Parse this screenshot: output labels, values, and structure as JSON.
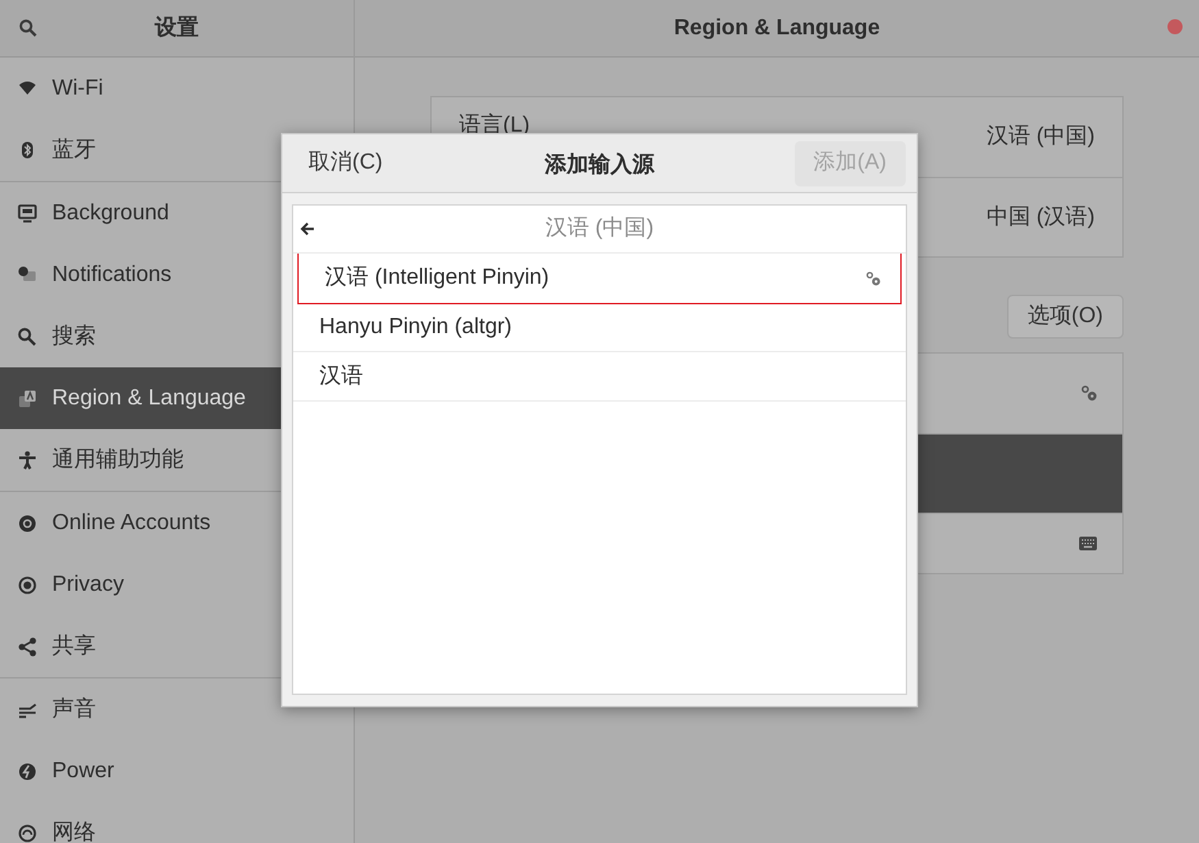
{
  "window": {
    "sidebar_title": "设置",
    "title": "Region & Language"
  },
  "sidebar": {
    "groups": [
      [
        {
          "kind": "wifi",
          "label": "Wi-Fi",
          "selected": false
        },
        {
          "kind": "bluetooth",
          "label": "蓝牙",
          "selected": false
        }
      ],
      [
        {
          "kind": "background",
          "label": "Background",
          "selected": false
        },
        {
          "kind": "notifications",
          "label": "Notifications",
          "selected": false
        },
        {
          "kind": "search",
          "label": "搜索",
          "selected": false
        },
        {
          "kind": "region",
          "label": "Region & Language",
          "selected": true
        },
        {
          "kind": "accessibility",
          "label": "通用辅助功能",
          "selected": false
        }
      ],
      [
        {
          "kind": "online",
          "label": "Online Accounts",
          "selected": false
        },
        {
          "kind": "privacy",
          "label": "Privacy",
          "selected": false
        },
        {
          "kind": "share",
          "label": "共享",
          "selected": false
        }
      ],
      [
        {
          "kind": "sound",
          "label": "声音",
          "selected": false
        },
        {
          "kind": "power",
          "label": "Power",
          "selected": false
        },
        {
          "kind": "network",
          "label": "网络",
          "selected": false
        }
      ]
    ]
  },
  "language_rows": [
    {
      "label": "语言(L)",
      "value": "汉语 (中国)"
    },
    {
      "value": "中国 (汉语)"
    }
  ],
  "options_button": "选项(O)",
  "input_sources": [
    {
      "kind": "settings",
      "selected": false
    },
    {
      "kind": "plain",
      "selected": true
    },
    {
      "kind": "keyboard",
      "selected": false
    }
  ],
  "dialog": {
    "cancel": "取消(C)",
    "title": "添加输入源",
    "add": {
      "label": "添加(A)",
      "disabled": true
    },
    "back_label": "汉语 (中国)",
    "items": [
      {
        "label": "汉语 (Intelligent Pinyin)",
        "selected": true,
        "settings": true
      },
      {
        "label": "Hanyu Pinyin (altgr)",
        "selected": false,
        "settings": false
      },
      {
        "label": "汉语",
        "selected": false,
        "settings": false
      }
    ]
  }
}
